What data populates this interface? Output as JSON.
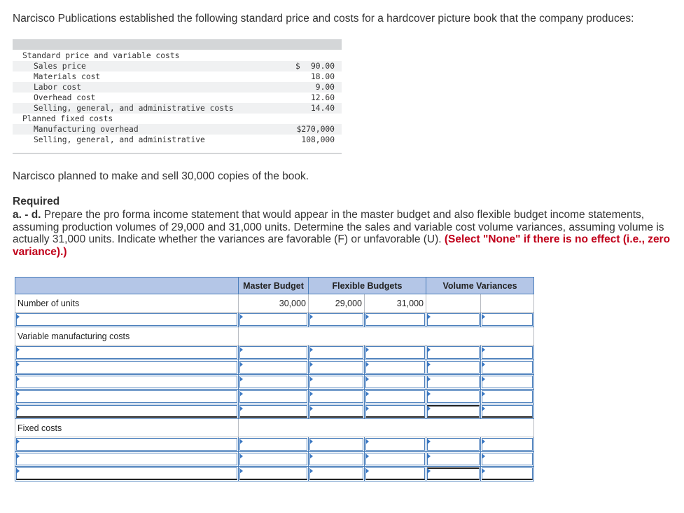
{
  "intro": "Narcisco Publications established the following standard price and costs for a hardcover picture book that the company produces:",
  "standard_table": {
    "rows": [
      {
        "label": "Standard price and variable costs",
        "value": "",
        "currency": ""
      },
      {
        "label": "Sales price",
        "value": "90.00",
        "currency": "$"
      },
      {
        "label": "Materials cost",
        "value": "18.00",
        "currency": ""
      },
      {
        "label": "Labor cost",
        "value": "9.00",
        "currency": ""
      },
      {
        "label": "Overhead cost",
        "value": "12.60",
        "currency": ""
      },
      {
        "label": "Selling, general, and administrative costs",
        "value": "14.40",
        "currency": ""
      },
      {
        "label": "Planned fixed costs",
        "value": "",
        "currency": ""
      },
      {
        "label": "Manufacturing overhead",
        "value": "$270,000",
        "currency": ""
      },
      {
        "label": "Selling, general, and administrative",
        "value": "108,000",
        "currency": ""
      }
    ]
  },
  "planned": "Narcisco planned to make and sell 30,000 copies of the book.",
  "required": {
    "heading": "Required",
    "tag": "a. - d.",
    "body": " Prepare the pro forma income statement that would appear in the master budget and also flexible budget income statements, assuming production volumes of 29,000 and 31,000 units. Determine the sales and variable cost volume variances, assuming volume is actually 31,000 units. Indicate whether the variances are favorable (F) or unfavorable (U). ",
    "note": "(Select \"None\" if there is no effect (i.e., zero variance).)"
  },
  "answer_table": {
    "headers": {
      "master": "Master Budget",
      "flexible": "Flexible Budgets",
      "variances": "Volume Variances"
    },
    "units_label": "Number of units",
    "units": [
      "30,000",
      "29,000",
      "31,000"
    ],
    "variable_label": "Variable manufacturing costs",
    "fixed_label": "Fixed costs"
  }
}
